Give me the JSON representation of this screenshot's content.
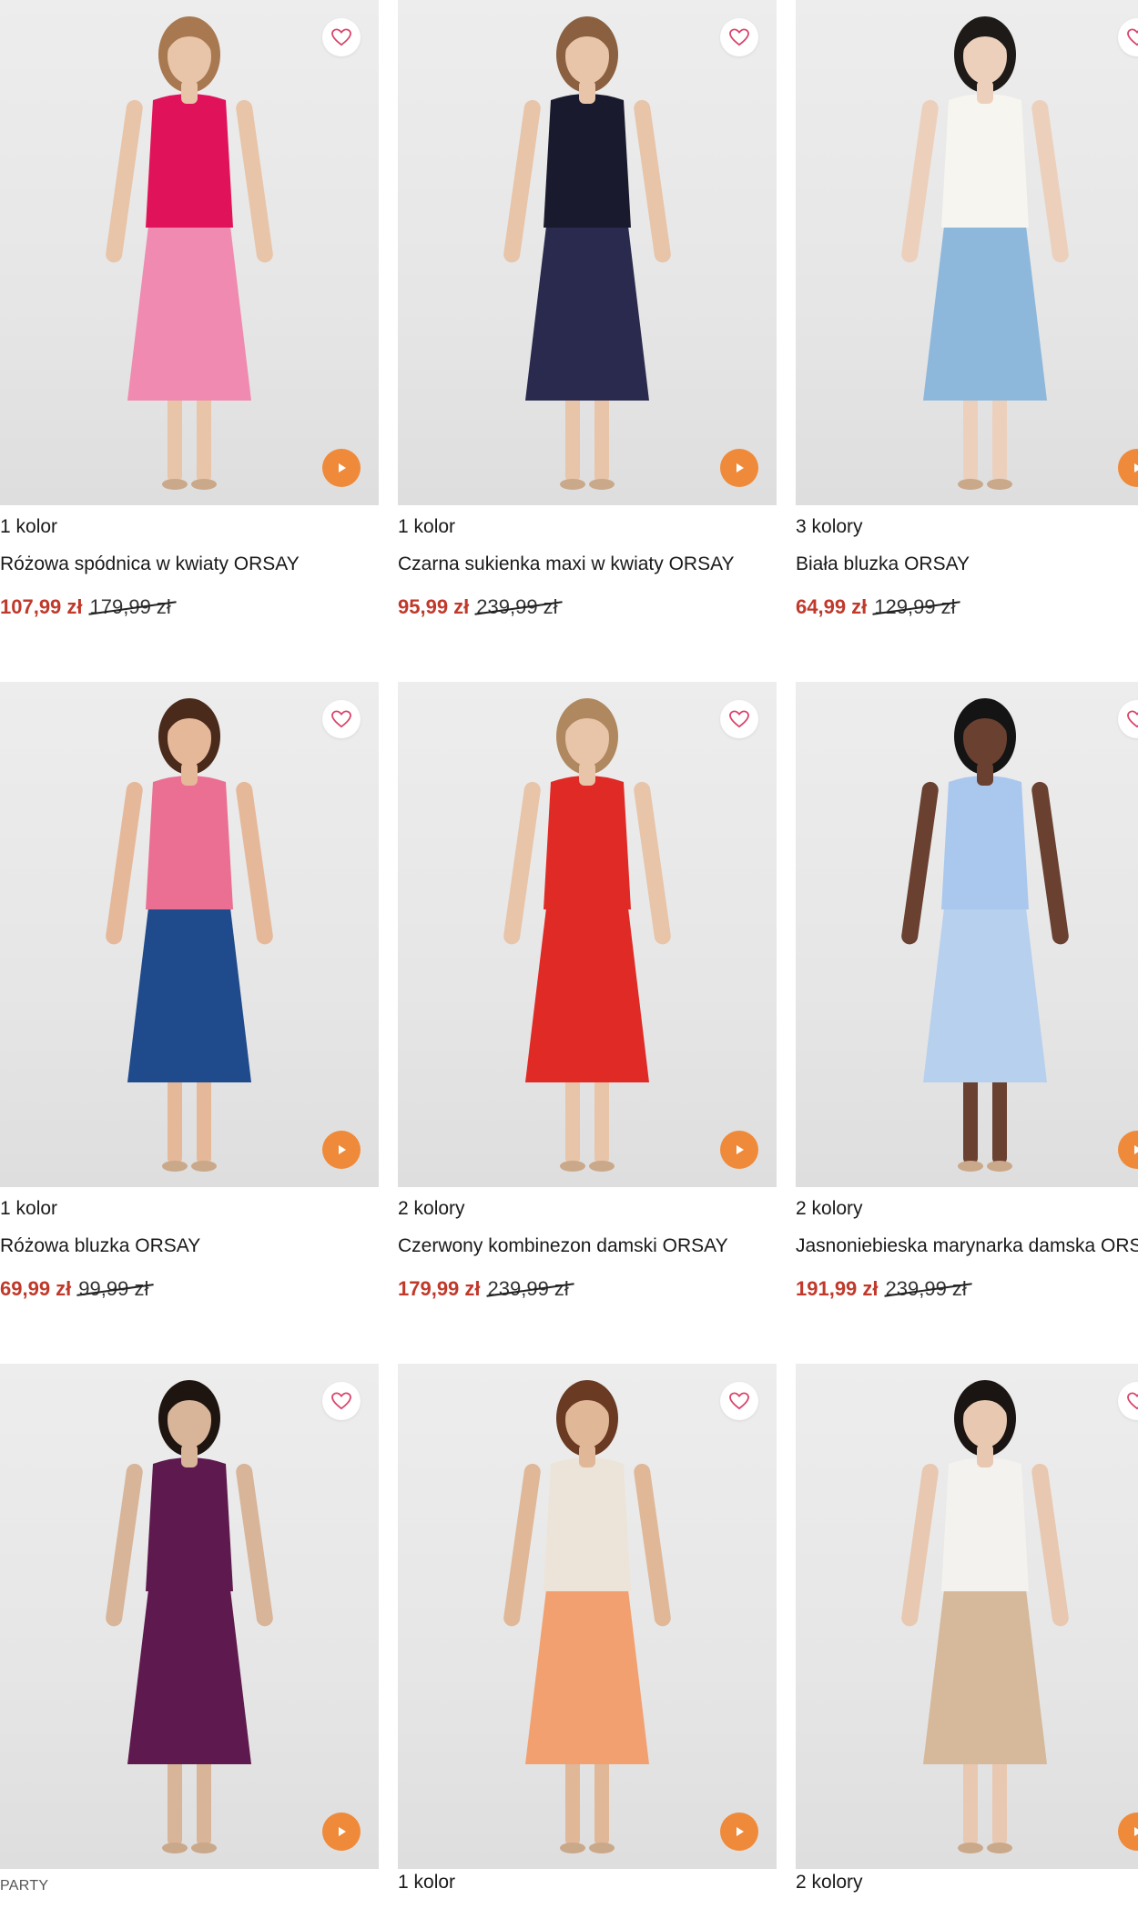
{
  "products": [
    {
      "colors": "1 kolor",
      "title": "Różowa spódnica w kwiaty ORSAY",
      "price": "107,99 zł",
      "old_price": "179,99 zł",
      "palette": {
        "top": "#e0125a",
        "bottom": "#f08ab0",
        "skin": "#e8c4a8",
        "hair": "#a87850"
      }
    },
    {
      "colors": "1 kolor",
      "title": "Czarna sukienka maxi w kwiaty ORSAY",
      "price": "95,99 zł",
      "old_price": "239,99 zł",
      "palette": {
        "top": "#1a1a2e",
        "bottom": "#2a2a4e",
        "skin": "#e8c4a8",
        "hair": "#8a6040"
      }
    },
    {
      "colors": "3 kolory",
      "title": "Biała bluzka ORSAY",
      "price": "64,99 zł",
      "old_price": "129,99 zł",
      "palette": {
        "top": "#f7f5ef",
        "bottom": "#8db8dc",
        "skin": "#ecd0bc",
        "hair": "#1e1a18"
      }
    },
    {
      "colors": "1 kolor",
      "title": "Różowa bluzka ORSAY",
      "price": "69,99 zł",
      "old_price": "99,99 zł",
      "palette": {
        "top": "#ea6f92",
        "bottom": "#1f4a8c",
        "skin": "#e6b89a",
        "hair": "#4a2a1a"
      }
    },
    {
      "colors": "2 kolory",
      "title": "Czerwony kombinezon damski ORSAY",
      "price": "179,99 zł",
      "old_price": "239,99 zł",
      "palette": {
        "top": "#e02a26",
        "bottom": "#e02a26",
        "skin": "#e8c4a8",
        "hair": "#b08860"
      }
    },
    {
      "colors": "2 kolory",
      "title": "Jasnoniebieska marynarka damska ORSAY",
      "price": "191,99 zł",
      "old_price": "239,99 zł",
      "palette": {
        "top": "#aac8ee",
        "bottom": "#b6d0ee",
        "skin": "#6a4030",
        "hair": "#141414"
      }
    },
    {
      "colors": "",
      "title": "",
      "price": "",
      "old_price": "",
      "palette": {
        "top": "#5e1a4e",
        "bottom": "#5e1a4e",
        "skin": "#d8b498",
        "hair": "#1e1410"
      }
    },
    {
      "colors": "1 kolor",
      "title": "",
      "price": "",
      "old_price": "",
      "palette": {
        "top": "#ece4d8",
        "bottom": "#f2a070",
        "skin": "#e0b898",
        "hair": "#6a3a22"
      }
    },
    {
      "colors": "2 kolory",
      "title": "",
      "price": "",
      "old_price": "",
      "palette": {
        "top": "#f4f2ee",
        "bottom": "#d6b89a",
        "skin": "#e8c8b0",
        "hair": "#1a1512"
      }
    }
  ],
  "badge_party": "PARTY",
  "accent": "#ef8a3a",
  "sale_color": "#c0392b",
  "icons": {
    "wishlist": "heart-icon",
    "video": "play-icon"
  }
}
